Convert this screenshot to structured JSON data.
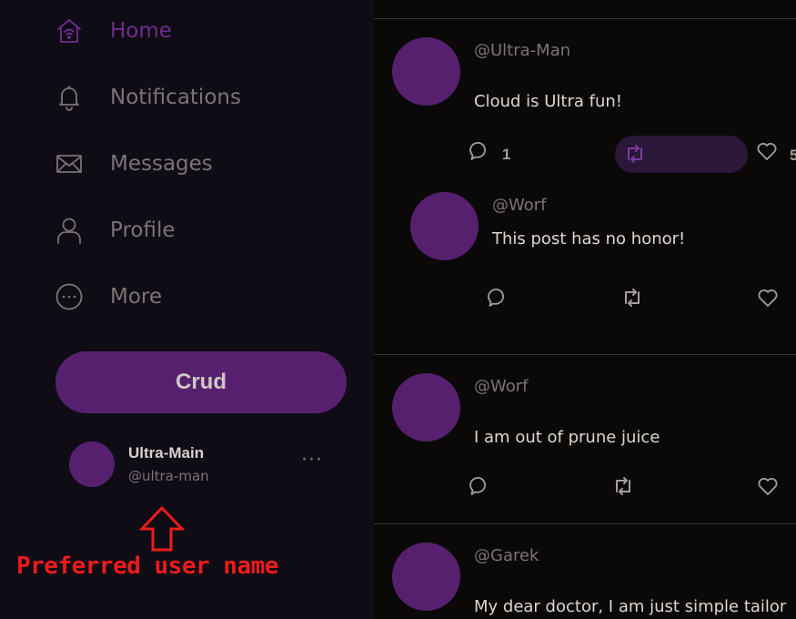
{
  "nav": {
    "home": "Home",
    "notifications": "Notifications",
    "messages": "Messages",
    "profile": "Profile",
    "more": "More"
  },
  "compose_button": "Crud",
  "account": {
    "display_name": "Ultra-Main",
    "handle": "@ultra-man",
    "more": "···"
  },
  "annotation": "Preferred user name",
  "colors": {
    "accent": "#56206f",
    "active_nav": "#6f2c8f",
    "annotation": "#ee1b1b",
    "sidebar_bg": "#0f0c15",
    "feed_bg": "#0a0908"
  },
  "posts": [
    {
      "handle": "@Ultra-Man",
      "text": "Cloud is Ultra fun!",
      "reply_count": "1",
      "retweet_count": "",
      "like_count": "5"
    },
    {
      "handle": "@Worf",
      "text": "This post has no honor!"
    },
    {
      "handle": "@Worf",
      "text": "I am out of prune juice"
    },
    {
      "handle": "@Garek",
      "text": "My dear doctor, I am just simple tailor"
    }
  ]
}
